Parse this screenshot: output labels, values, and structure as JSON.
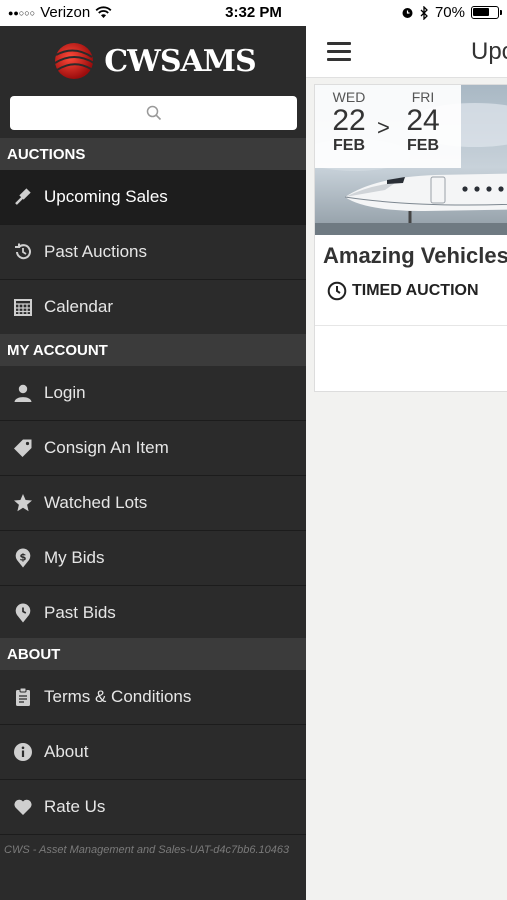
{
  "status_bar": {
    "carrier": "Verizon",
    "time": "3:32 PM",
    "battery": "70%",
    "battery_level": 0.7
  },
  "drawer": {
    "brand": "CWSAMS",
    "search": {
      "placeholder": ""
    },
    "sections": [
      {
        "header": "AUCTIONS"
      },
      {
        "header": "MY ACCOUNT"
      },
      {
        "header": "ABOUT"
      }
    ],
    "items": {
      "upcoming_sales": "Upcoming Sales",
      "past_auctions": "Past Auctions",
      "calendar": "Calendar",
      "login": "Login",
      "consign": "Consign An Item",
      "watched_lots": "Watched Lots",
      "my_bids": "My Bids",
      "past_bids": "Past Bids",
      "terms": "Terms & Conditions",
      "about": "About",
      "rate_us": "Rate Us"
    },
    "footer": "CWS - Asset Management and Sales-UAT-d4c7bb6.10463"
  },
  "content": {
    "title": "Upcoming Sales",
    "card": {
      "start_dow": "WED",
      "start_day": "22",
      "start_month": "FEB",
      "end_dow": "FRI",
      "end_day": "24",
      "end_month": "FEB",
      "arrow": ">",
      "title": "Amazing Vehicles",
      "type": "TIMED AUCTION"
    }
  }
}
